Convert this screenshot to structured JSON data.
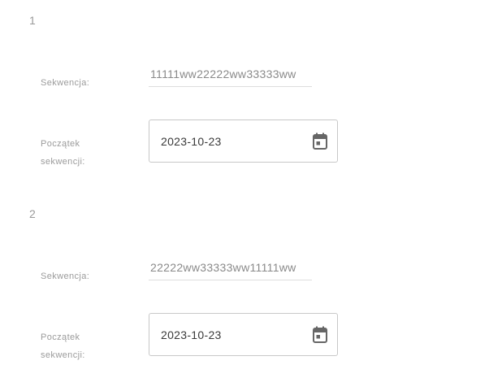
{
  "entries": [
    {
      "number": "1",
      "sequence_label": "Sekwencja:",
      "sequence_value": "11111ww22222ww33333ww",
      "start_label_line1": "Początek",
      "start_label_line2": "sekwencji:",
      "start_date": "2023-10-23",
      "calendar_icon": "calendar-icon"
    },
    {
      "number": "2",
      "sequence_label": "Sekwencja:",
      "sequence_value": "22222ww33333ww11111ww",
      "start_label_line1": "Początek",
      "start_label_line2": "sekwencji:",
      "start_date": "2023-10-23",
      "calendar_icon": "calendar-icon"
    }
  ]
}
